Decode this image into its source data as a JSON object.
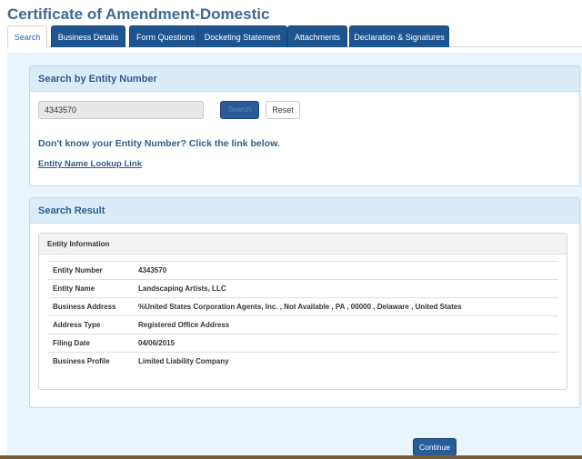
{
  "page_title": "Certificate of Amendment-Domestic",
  "tabs": [
    {
      "label": "Search",
      "active": true
    },
    {
      "label": "Business Details",
      "active": false
    },
    {
      "label": "Form Questions",
      "active": false
    },
    {
      "label": "Docketing Statement",
      "active": false
    },
    {
      "label": "Attachments",
      "active": false
    },
    {
      "label": "Declaration & Signatures",
      "active": false
    }
  ],
  "search_panel": {
    "heading": "Search by Entity Number",
    "entity_number_value": "4343570",
    "search_button": "Search",
    "reset_button": "Reset",
    "help_text": "Don't know your Entity Number? Click the link below.",
    "lookup_link": "Entity Name Lookup Link"
  },
  "result_panel": {
    "heading": "Search Result",
    "info_heading": "Entity Information",
    "rows": [
      {
        "label": "Entity Number",
        "value": "4343570"
      },
      {
        "label": "Entity Name",
        "value": "Landscaping Artists, LLC"
      },
      {
        "label": "Business Address",
        "value": "%United States Corporation Agents, Inc. , Not Available , PA , 00000 , Delaware , United States"
      },
      {
        "label": "Address Type",
        "value": "Registered Office Address"
      },
      {
        "label": "Filing Date",
        "value": "04/06/2015"
      },
      {
        "label": "Business Profile",
        "value": "Limited Liability Company"
      }
    ]
  },
  "continue_button": "Continue",
  "colors": {
    "tab_bg": "#1e5590",
    "panel_head_bg": "#d9ecf8",
    "content_bg": "#eaf4fc",
    "title": "#3d6a94"
  }
}
